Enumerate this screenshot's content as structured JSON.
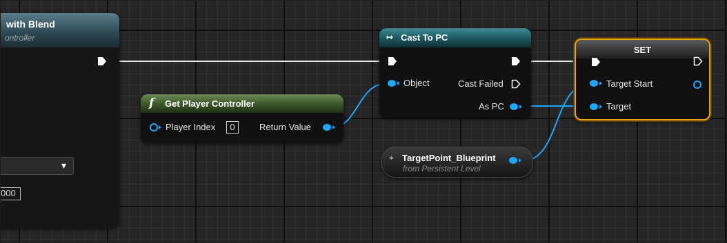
{
  "nodes": {
    "blend": {
      "title": "with Blend",
      "subtitle": "ontroller",
      "number_field": "000",
      "dropdown_arrow": "▾"
    },
    "get_player_controller": {
      "function_glyph": "f",
      "title": "Get Player Controller",
      "player_index_label": "Player Index",
      "player_index_value": "0",
      "return_value_label": "Return Value"
    },
    "cast": {
      "icon": "↦",
      "title": "Cast To PC",
      "object_label": "Object",
      "cast_failed_label": "Cast Failed",
      "as_pc_label": "As PC"
    },
    "target_point": {
      "icon": "⌖",
      "title": "TargetPoint_Blueprint",
      "subtitle": "from Persistent Level"
    },
    "set": {
      "title": "SET",
      "target_start_label": "Target Start",
      "target_label": "Target"
    }
  },
  "colors": {
    "object_pin": "#1da7ff",
    "exec_pin": "#ffffff",
    "function_header": "#3d5a2b",
    "cast_header": "#1f5a63",
    "selection": "#e8a30e",
    "node_body": "#111111"
  },
  "icons": [
    "function-icon",
    "cast-icon",
    "actor-reference-icon",
    "exec-pin-icon",
    "object-pin-icon",
    "dropdown-arrow-icon"
  ]
}
